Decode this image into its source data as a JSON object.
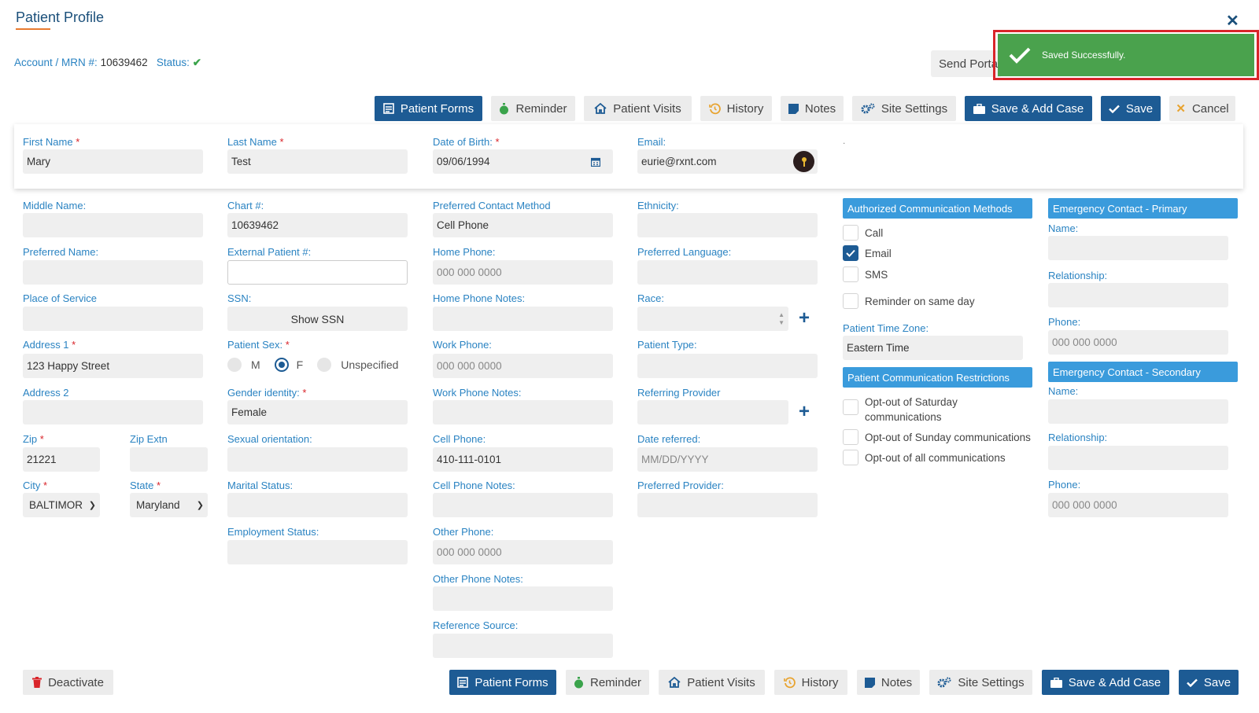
{
  "header": {
    "title": "Patient Profile",
    "account_label": "Account / MRN #:",
    "account_value": "10639462",
    "status_label": "Status:"
  },
  "send_portal": {
    "label": "Send Portal"
  },
  "toast": {
    "message": "Saved Successfully."
  },
  "toolbar": {
    "patient_forms": "Patient Forms",
    "reminder": "Reminder",
    "patient_visits": "Patient Visits",
    "history": "History",
    "notes": "Notes",
    "site_settings": "Site Settings",
    "save_add_case": "Save & Add Case",
    "save": "Save",
    "cancel": "Cancel",
    "deactivate": "Deactivate"
  },
  "top_fields": {
    "first_name_label": "First Name",
    "first_name": "Mary",
    "last_name_label": "Last Name",
    "last_name": "Test",
    "dob_label": "Date of Birth:",
    "dob": "09/06/1994",
    "email_label": "Email:",
    "email": "eurie@rxnt.com"
  },
  "col1": {
    "middle_name_label": "Middle Name:",
    "preferred_name_label": "Preferred Name:",
    "place_of_service_label": "Place of Service",
    "address1_label": "Address 1",
    "address1": "123 Happy Street",
    "address2_label": "Address 2",
    "zip_label": "Zip",
    "zip": "21221",
    "zip_extn_label": "Zip Extn",
    "city_label": "City",
    "city": "BALTIMOR",
    "state_label": "State",
    "state": "Maryland"
  },
  "col2": {
    "chart_label": "Chart #:",
    "chart": "10639462",
    "external_patient_label": "External Patient #:",
    "ssn_label": "SSN:",
    "show_ssn": "Show SSN",
    "patient_sex_label": "Patient Sex:",
    "sex_m": "M",
    "sex_f": "F",
    "sex_unspecified": "Unspecified",
    "gender_identity_label": "Gender identity:",
    "gender_identity": "Female",
    "sexual_orientation_label": "Sexual orientation:",
    "marital_status_label": "Marital Status:",
    "employment_status_label": "Employment Status:"
  },
  "col3": {
    "preferred_contact_label": "Preferred Contact Method",
    "preferred_contact": "Cell Phone",
    "home_phone_label": "Home Phone:",
    "home_phone_ph": "000 000 0000",
    "home_phone_notes_label": "Home Phone Notes:",
    "work_phone_label": "Work Phone:",
    "work_phone_ph": "000 000 0000",
    "work_phone_notes_label": "Work Phone Notes:",
    "cell_phone_label": "Cell Phone:",
    "cell_phone": "410-111-0101",
    "cell_phone_notes_label": "Cell Phone Notes:",
    "other_phone_label": "Other Phone:",
    "other_phone_ph": "000 000 0000",
    "other_phone_notes_label": "Other Phone Notes:",
    "reference_source_label": "Reference Source:"
  },
  "col4": {
    "ethnicity_label": "Ethnicity:",
    "preferred_language_label": "Preferred Language:",
    "race_label": "Race:",
    "patient_type_label": "Patient Type:",
    "referring_provider_label": "Referring Provider",
    "date_referred_label": "Date referred:",
    "date_referred_ph": "MM/DD/YYYY",
    "preferred_provider_label": "Preferred Provider:"
  },
  "comm": {
    "authorized_header": "Authorized Communication Methods",
    "call": "Call",
    "email": "Email",
    "sms": "SMS",
    "reminder_same_day": "Reminder on same day",
    "time_zone_label": "Patient Time Zone:",
    "time_zone": "Eastern Time",
    "restrictions_header": "Patient Communication Restrictions",
    "optout_sat": "Opt-out of Saturday communications",
    "optout_sun": "Opt-out of Sunday communications",
    "optout_all": "Opt-out of all communications"
  },
  "emergency": {
    "primary_header": "Emergency Contact - Primary",
    "secondary_header": "Emergency Contact - Secondary",
    "name_label": "Name:",
    "relationship_label": "Relationship:",
    "phone_label": "Phone:",
    "phone_ph": "000 000 0000"
  },
  "colors": {
    "primary": "#1d5b94",
    "accent": "#3a9bdc",
    "success": "#4aa24d",
    "required": "#d9252a"
  }
}
